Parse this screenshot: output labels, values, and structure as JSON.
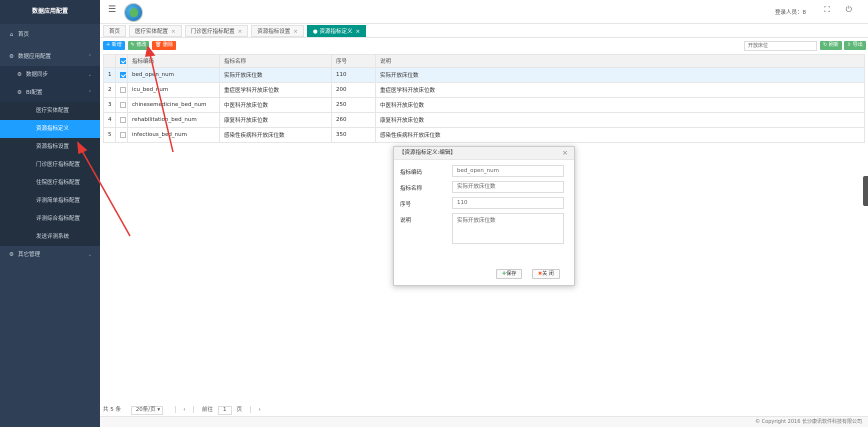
{
  "app": {
    "title": "数据应用配置"
  },
  "sidebar": {
    "home": "首页",
    "data_app_config": "数据应用配置",
    "data_sync": "数据同步",
    "bi_config": "BI配置",
    "items": [
      "医疗实体配置",
      "资源指标定义",
      "资源指标设置",
      "门诊医疗指标配置",
      "住院医疗指标配置",
      "评测简单指标配置",
      "评测综合指标配置",
      "发送评测系统"
    ],
    "other_mgmt": "其它管理"
  },
  "topbar": {
    "login_user": "登录人员：",
    "login_value": "8"
  },
  "tabs": [
    {
      "label": "首页"
    },
    {
      "label": "医疗实体配置"
    },
    {
      "label": "门诊医疗指标配置"
    },
    {
      "label": "资源指标设置"
    },
    {
      "label": "资源指标定义"
    }
  ],
  "toolbar": {
    "add": "新增",
    "edit": "修改",
    "delete": "删除",
    "search_value": "开放床位",
    "refresh": "刷新",
    "export": "导出"
  },
  "table": {
    "headers": [
      "",
      "",
      "指标编码",
      "指标名称",
      "序号",
      "说明"
    ],
    "rows": [
      {
        "no": "1",
        "checked": true,
        "code": "bed_open_num",
        "name": "实际开放床位数",
        "seq": "110",
        "desc": "实际开放床位数"
      },
      {
        "no": "2",
        "checked": false,
        "code": "icu_bed_num",
        "name": "重症医学科开放床位数",
        "seq": "200",
        "desc": "重症医学科开放床位数"
      },
      {
        "no": "3",
        "checked": false,
        "code": "chinesemedicine_bed_num",
        "name": "中医科开放床位数",
        "seq": "250",
        "desc": "中医科开放床位数"
      },
      {
        "no": "4",
        "checked": false,
        "code": "rehabilitation_bed_num",
        "name": "康复科开放床位数",
        "seq": "260",
        "desc": "康复科开放床位数"
      },
      {
        "no": "5",
        "checked": false,
        "code": "infectious_bed_num",
        "name": "感染性疾病科开放床位数",
        "seq": "350",
        "desc": "感染性疾病科开放床位数"
      }
    ]
  },
  "dialog": {
    "title": "【资源指标定义:编辑】",
    "code_label": "指标编码",
    "code_value": "bed_open_num",
    "name_label": "指标名称",
    "name_value": "实际开放床位数",
    "seq_label": "序号",
    "seq_value": "110",
    "desc_label": "说明",
    "desc_value": "实际开放床位数",
    "save": "保存",
    "close": "关 闭"
  },
  "pager": {
    "total": "共 5 条",
    "page_size": "20条/页",
    "prev": "前往",
    "page": "1",
    "page_suffix": "页"
  },
  "footer": {
    "copyright": "© Copyright 2016 长沙康讯软件科技有限公司"
  },
  "colors": {
    "sidebar": "#2f4056",
    "active": "#1e9fff",
    "tab_active": "#009688",
    "arrow": "#e53935"
  }
}
